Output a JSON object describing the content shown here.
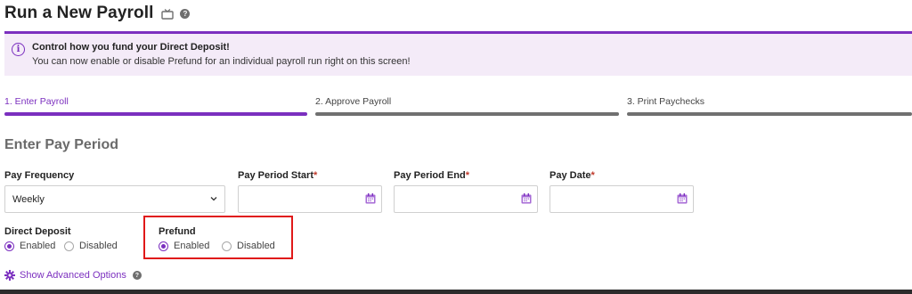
{
  "page": {
    "title": "Run a New Payroll",
    "help_glyph": "?"
  },
  "banner": {
    "icon_glyph": "i",
    "title": "Control how you fund your Direct Deposit!",
    "text": "You can now enable or disable Prefund for an individual payroll run right on this screen!"
  },
  "steps": [
    {
      "label": "1. Enter Payroll",
      "active": true
    },
    {
      "label": "2. Approve Payroll",
      "active": false
    },
    {
      "label": "3. Print Paychecks",
      "active": false
    }
  ],
  "section": {
    "title": "Enter Pay Period"
  },
  "fields": {
    "pay_frequency": {
      "label": "Pay Frequency",
      "value": "Weekly"
    },
    "pay_period_start": {
      "label": "Pay Period Start",
      "required_mark": "*",
      "value": ""
    },
    "pay_period_end": {
      "label": "Pay Period End",
      "required_mark": "*",
      "value": ""
    },
    "pay_date": {
      "label": "Pay Date",
      "required_mark": "*",
      "value": ""
    }
  },
  "direct_deposit": {
    "label": "Direct Deposit",
    "options": [
      {
        "label": "Enabled",
        "checked": true
      },
      {
        "label": "Disabled",
        "checked": false
      }
    ]
  },
  "prefund": {
    "label": "Prefund",
    "options": [
      {
        "label": "Enabled",
        "checked": true
      },
      {
        "label": "Disabled",
        "checked": false
      }
    ]
  },
  "advanced": {
    "link_label": "Show Advanced Options",
    "help_glyph": "?"
  },
  "colors": {
    "accent": "#7b2fbf",
    "banner_bg": "#f4ebf8",
    "inactive_step": "#707070",
    "highlight": "#e01919"
  },
  "icons": {
    "title_icon": "tv-icon",
    "banner_icon": "info-icon",
    "calendar": "calendar-icon",
    "select": "chevron-down-icon",
    "advanced": "gear-icon"
  }
}
